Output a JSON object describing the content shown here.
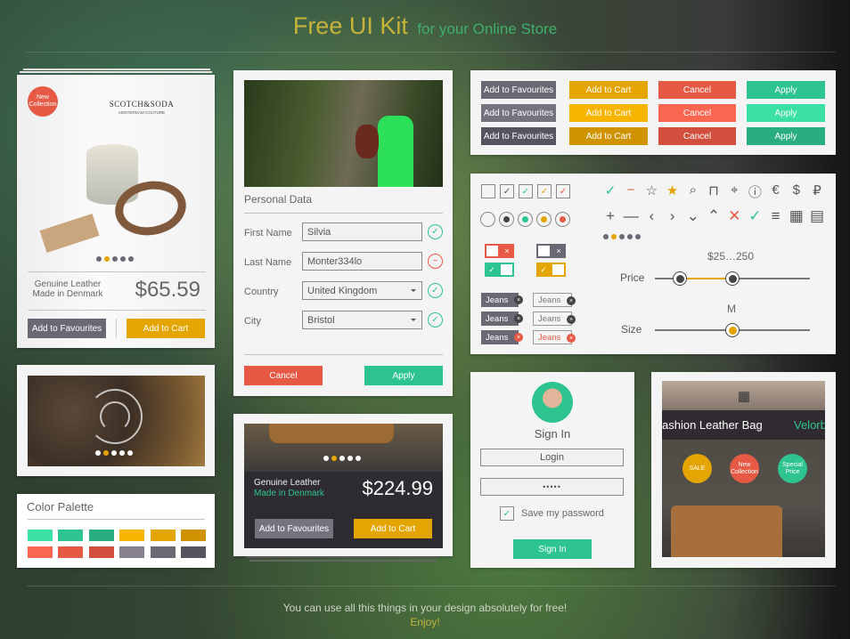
{
  "header": {
    "title": "Free UI Kit",
    "subtitle": "for your Online Store"
  },
  "product_card": {
    "badge": "New Collection",
    "brand": "SCOTCH&SODA",
    "brand_sub": "AMSTERDAM COUTURE",
    "desc1": "Genuine Leather",
    "desc2": "Made in Denmark",
    "price": "$65.59",
    "fav": "Add to Favourites",
    "cart": "Add to Cart",
    "active_dot": 1
  },
  "slider_card": {
    "active_dot": 1
  },
  "palette": {
    "title": "Color Palette",
    "colors": [
      "#3be0a3",
      "#2ec48f",
      "#28ae7f",
      "#f7b500",
      "#e5a500",
      "#d09300",
      "#fb6650",
      "#e65a45",
      "#d24f3e",
      "#86808f",
      "#6b6874",
      "#57545f"
    ]
  },
  "personal": {
    "title": "Personal Data",
    "fields": [
      {
        "label": "First Name",
        "value": "Silvia",
        "status": "valid",
        "select": false
      },
      {
        "label": "Last Name",
        "value": "Monter334lo",
        "status": "invalid",
        "select": false
      },
      {
        "label": "Country",
        "value": "United Kingdom",
        "status": "valid",
        "select": true
      },
      {
        "label": "City",
        "value": "Bristol",
        "status": "valid",
        "select": true
      }
    ],
    "cancel": "Cancel",
    "apply": "Apply"
  },
  "dark_card": {
    "desc1": "Genuine Leather",
    "desc2": "Made in Denmark",
    "price": "$224.99",
    "fav": "Add to Favourites",
    "cart": "Add to Cart",
    "active_dot": 1
  },
  "buttons": {
    "labels": [
      "Add to Favourites",
      "Add to Cart",
      "Cancel",
      "Apply"
    ],
    "colors": [
      [
        "#6b6874",
        "#e5a500",
        "#e65a45",
        "#2ec48f"
      ],
      [
        "#76737f",
        "#f7b500",
        "#fb6650",
        "#3be0a3"
      ],
      [
        "#57545f",
        "#d09300",
        "#d24f3e",
        "#28ae7f"
      ]
    ]
  },
  "controls": {
    "checkbox_colors": [
      "",
      "#555",
      "#2ec48f",
      "#e5a500",
      "#e65a45"
    ],
    "radio_colors": [
      "",
      "#444",
      "#2ec48f",
      "#e5a500",
      "#e65a45"
    ],
    "icons": [
      "check-circle",
      "minus-circle",
      "star-outline",
      "star-filled",
      "search",
      "shopping-bag",
      "map-pin",
      "info",
      "euro",
      "dollar",
      "ruble"
    ],
    "icons2": [
      "plus",
      "minus",
      "chevron-left",
      "chevron-right",
      "chevron-down",
      "chevron-up",
      "close",
      "check",
      "menu",
      "grid-filled",
      "grid-outline"
    ],
    "active_dot": 1,
    "tag_label": "Jeans",
    "price_label": "Price",
    "price_range": "$25…250",
    "price_min": 25,
    "price_max": 250,
    "size_label": "Size",
    "size_value": "M"
  },
  "signin": {
    "title": "Sign In",
    "login_placeholder": "Login",
    "password": "•••••",
    "save": "Save my password",
    "save_checked": true,
    "button": "Sign In"
  },
  "bag": {
    "title": "ashion Leather Bag",
    "brand": "Velorb",
    "badges": [
      "SALE",
      "New Collection",
      "Special Price"
    ]
  },
  "footer": {
    "line1": "You can use all this things in your design absolutely for free!",
    "line2": "Enjoy!"
  }
}
